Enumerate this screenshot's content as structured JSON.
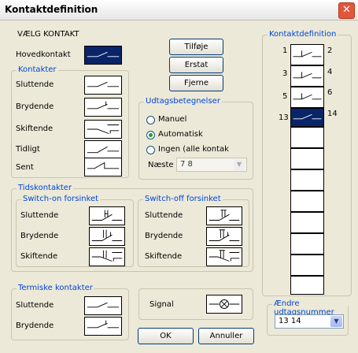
{
  "window": {
    "title": "Kontaktdefinition"
  },
  "select": {
    "heading": "VÆLG KONTAKT",
    "hovedkontakt_label": "Hovedkontakt"
  },
  "buttons": {
    "tilfoje": "Tilføje",
    "erstat": "Erstat",
    "fjerne": "Fjerne",
    "ok": "OK",
    "annuller": "Annuller"
  },
  "kontakter": {
    "legend": "Kontakter",
    "items": [
      "Sluttende",
      "Brydende",
      "Skiftende",
      "Tidligt",
      "Sent"
    ]
  },
  "udtags": {
    "legend": "Udtagsbetegnelser",
    "options": [
      "Manuel",
      "Automatisk",
      "Ingen (alle kontak"
    ],
    "selected": "Automatisk",
    "naeste_label": "Næste",
    "naeste_value": "7 8"
  },
  "tidskontakter": {
    "legend": "Tidskontakter",
    "on": {
      "legend": "Switch-on forsinket",
      "items": [
        "Sluttende",
        "Brydende",
        "Skiftende"
      ]
    },
    "off": {
      "legend": "Switch-off forsinket",
      "items": [
        "Sluttende",
        "Brydende",
        "Skiftende"
      ]
    }
  },
  "termiske": {
    "legend": "Termiske kontakter",
    "items": [
      "Sluttende",
      "Brydende"
    ]
  },
  "signal": {
    "label": "Signal"
  },
  "kontaktdef": {
    "legend": "Kontaktdefinition",
    "contacts": [
      {
        "left": "1",
        "right": "2"
      },
      {
        "left": "3",
        "right": "4"
      },
      {
        "left": "5",
        "right": "6"
      },
      {
        "left": "13",
        "right": "14"
      }
    ],
    "selected_contact": "13 14"
  },
  "aendre": {
    "legend": "Ændre udtagsnummer",
    "value": "13 14"
  },
  "icons": {
    "close": "close-icon",
    "dropdown": "chevron-down-icon"
  }
}
